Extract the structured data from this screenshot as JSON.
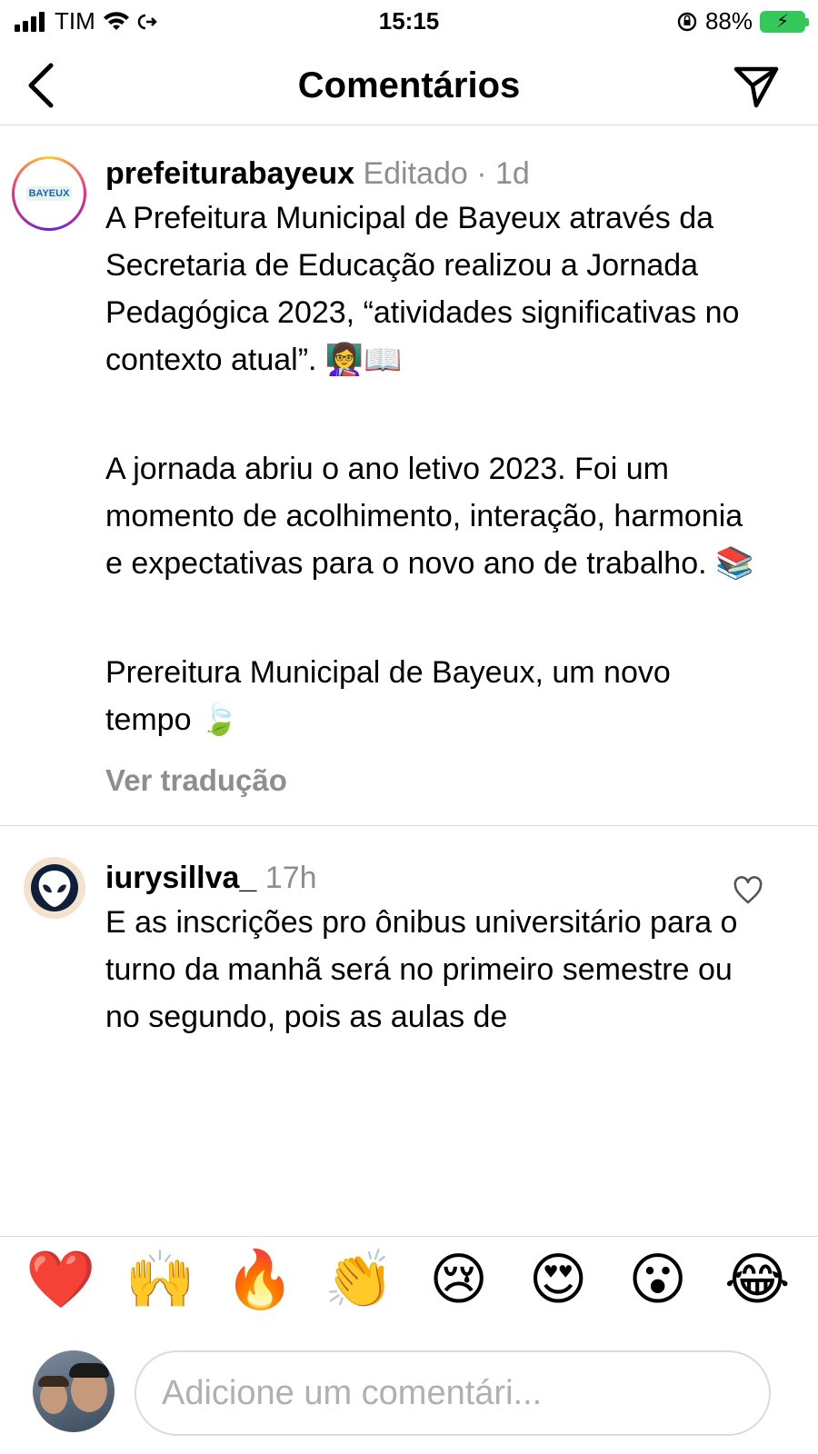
{
  "status_bar": {
    "carrier": "TIM",
    "time": "15:15",
    "battery": "88%"
  },
  "header": {
    "title": "Comentários"
  },
  "caption": {
    "username": "prefeiturabayeux",
    "meta": "Editado · 1d",
    "avatar_label": "BAYEUX",
    "paragraphs": [
      "A Prefeitura Municipal de Bayeux através da Secretaria de Educação realizou a Jornada Pedagógica 2023, “atividades significativas no contexto atual”. 👩‍🏫📖",
      "A jornada abriu o ano letivo 2023. Foi um momento de acolhimento, interação, harmonia e expectativas para o novo ano de trabalho. 📚",
      "Prereitura Municipal de Bayeux, um novo tempo 🍃"
    ],
    "translate_label": "Ver tradução"
  },
  "reply": {
    "username": "iurysillva_",
    "meta": "17h",
    "text": "E as inscrições pro ônibus universitário para o turno da manhã será no primeiro semestre ou no segundo, pois as aulas de"
  },
  "emoji_bar": [
    "❤️",
    "🙌",
    "🔥",
    "👏",
    "😢",
    "😍",
    "😮",
    "😂"
  ],
  "input": {
    "placeholder": "Adicione um comentári..."
  },
  "icons": {
    "back": "chevron-left-icon",
    "send": "paper-plane-icon",
    "like": "heart-outline-icon"
  }
}
